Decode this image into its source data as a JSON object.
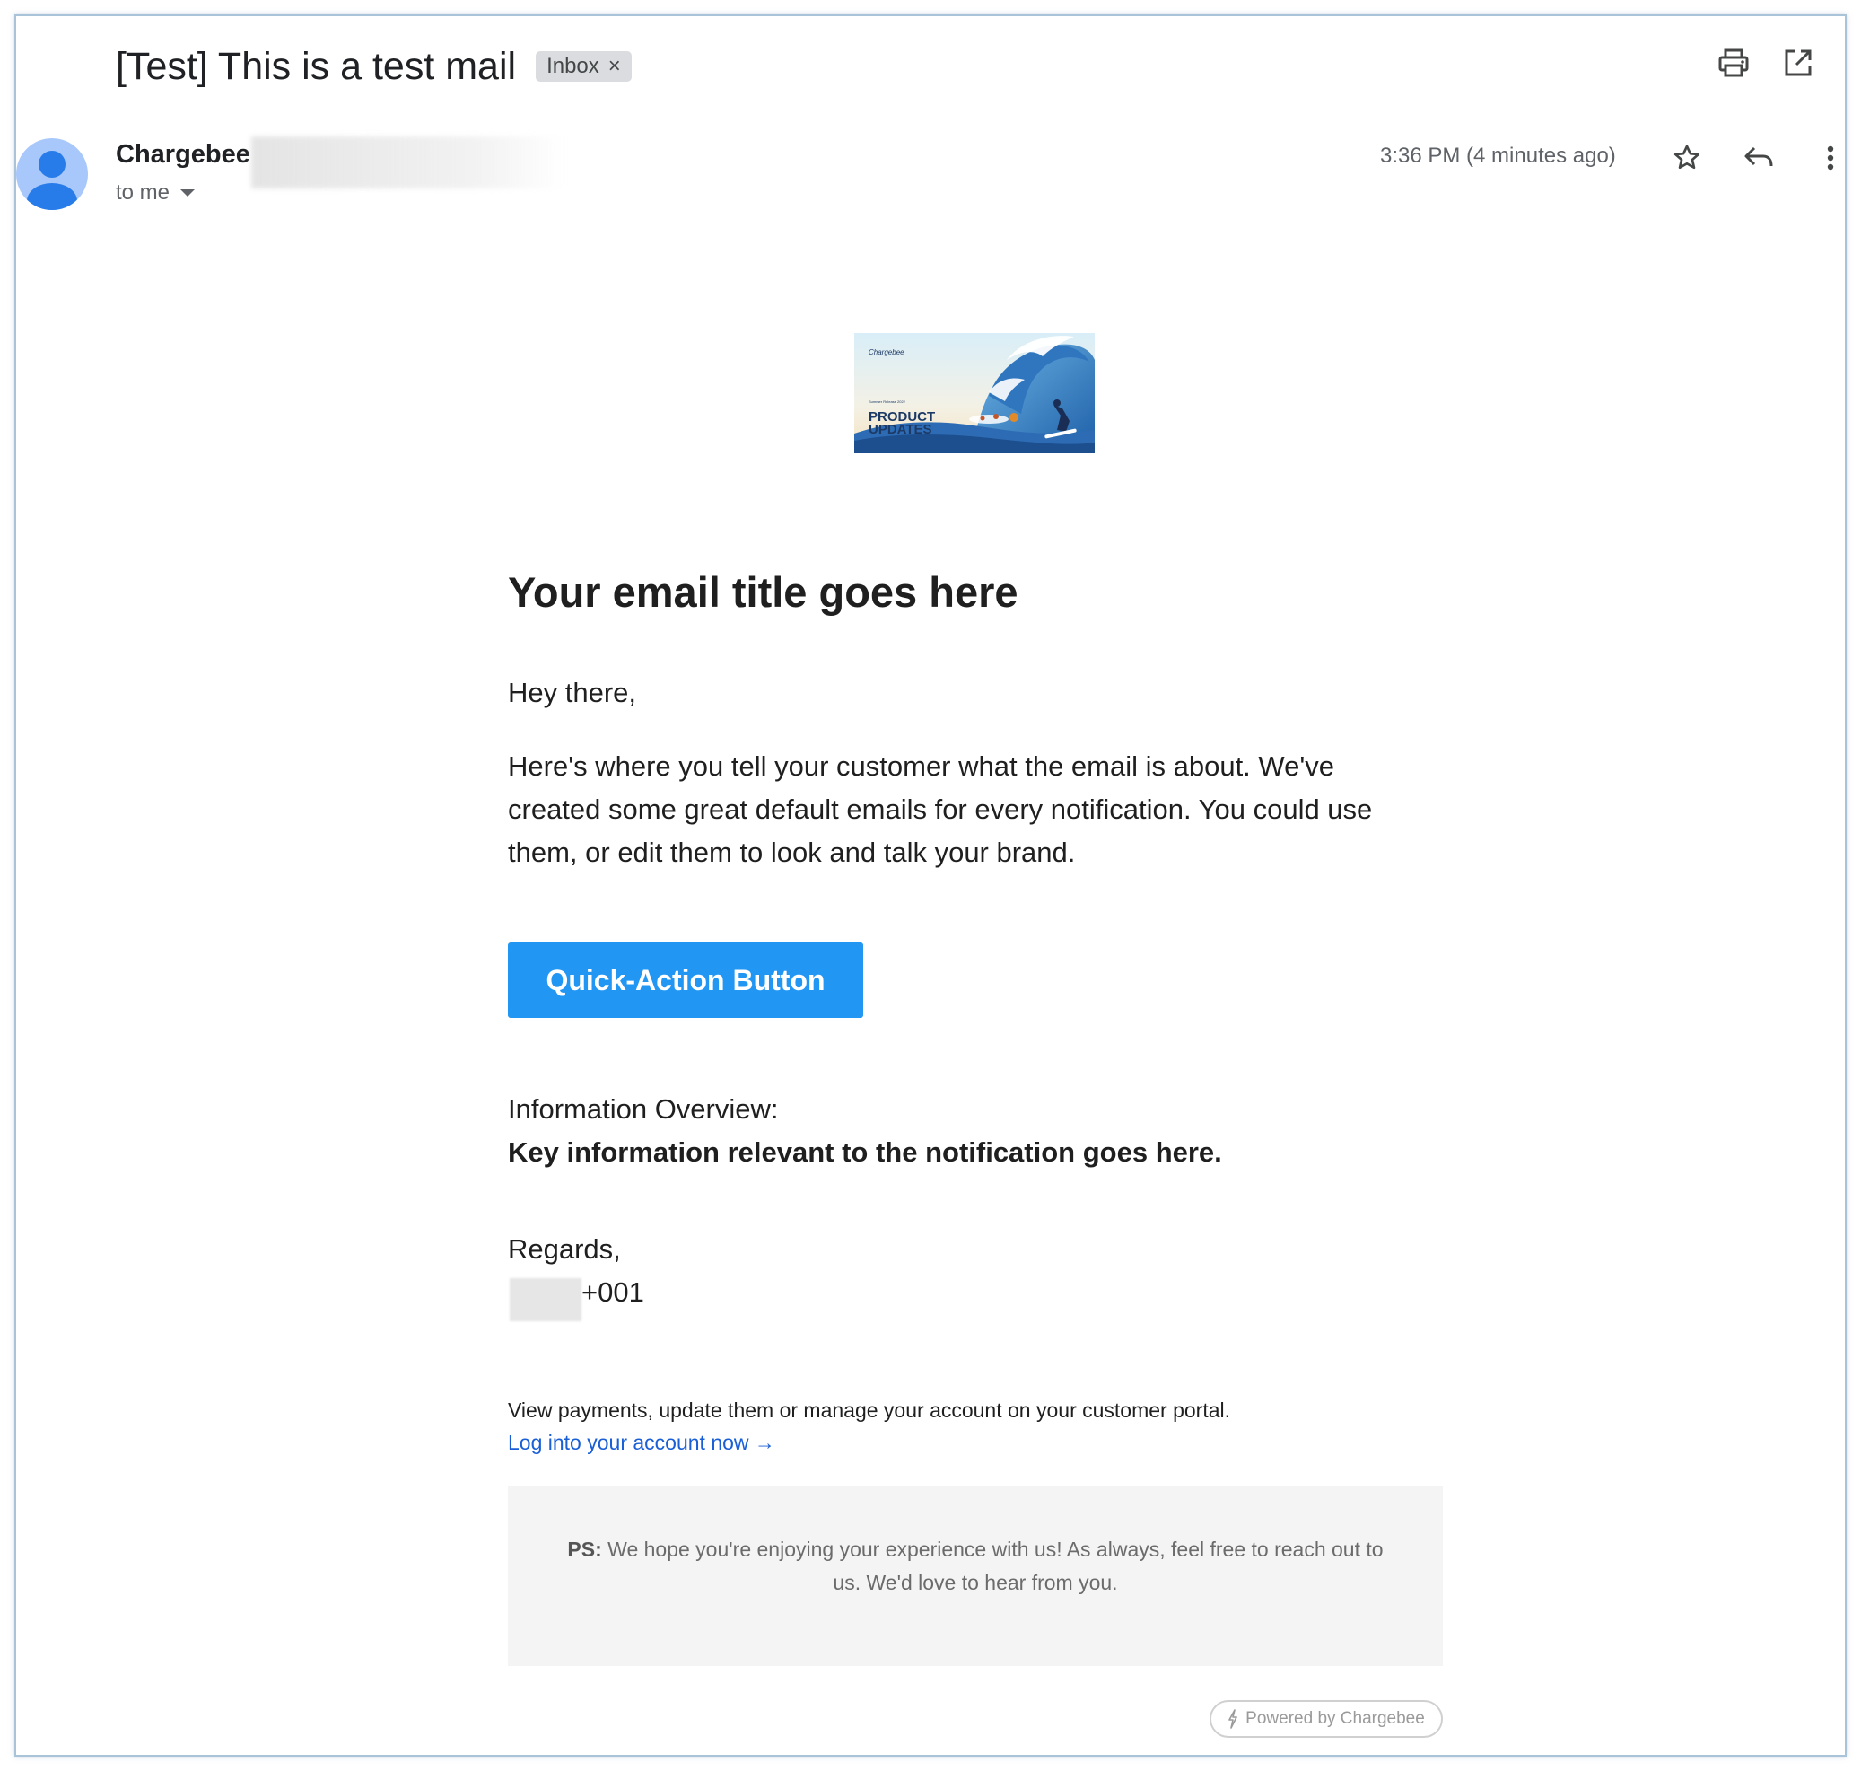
{
  "header": {
    "subject": "[Test] This is a test mail",
    "label_chip": "Inbox",
    "label_remove": "×"
  },
  "message": {
    "sender_name": "Chargebee",
    "recipient": "to me",
    "timestamp": "3:36 PM (4 minutes ago)"
  },
  "email": {
    "hero_logo_text": "Chargebee",
    "hero_small_text": "Summer Release 2022",
    "hero_title_line1": "PRODUCT",
    "hero_title_line2": "UPDATES",
    "title": "Your email title goes here",
    "greeting": "Hey there,",
    "paragraph_lines": [
      "Here's where you tell your customer what the email is about. We've",
      "created some great default emails for every notification. You could use",
      "them, or edit them to look and talk your brand."
    ],
    "button_label": "Quick-Action Button",
    "info_label": "Information Overview:",
    "info_key": "Key information relevant to the notification goes here.",
    "regards": "Regards,",
    "signature_code": "+001",
    "portal_text": "View payments, update them or manage your account on your customer portal.",
    "portal_link": "Log into your account now →",
    "ps_label": "PS:",
    "ps_text": " We hope you're enjoying your experience with us! As always, feel free to reach out to us. We'd love to hear from you.",
    "powered_by": "Powered by Chargebee"
  },
  "icons": {
    "print": "print-icon",
    "open_new": "open-in-new-window-icon",
    "star": "star-icon",
    "reply": "reply-icon",
    "more": "more-vertical-icon"
  },
  "colors": {
    "button": "#2196f3",
    "link": "#1a5fd6",
    "avatar": "#a8c7fa",
    "ps_background": "#f4f4f4"
  }
}
